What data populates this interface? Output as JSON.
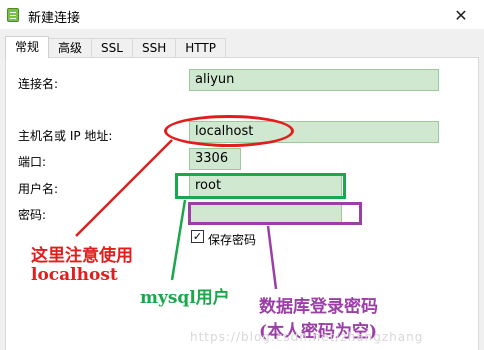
{
  "window": {
    "title": "新建连接",
    "close_glyph": "✕"
  },
  "tabs": [
    {
      "label": "常规"
    },
    {
      "label": "高级"
    },
    {
      "label": "SSL"
    },
    {
      "label": "SSH"
    },
    {
      "label": "HTTP"
    }
  ],
  "form": {
    "connection_name_label": "连接名:",
    "connection_name_value": "aliyun",
    "host_label": "主机名或 IP 地址:",
    "host_value": "localhost",
    "port_label": "端口:",
    "port_value": "3306",
    "user_label": "用户名:",
    "user_value": "root",
    "password_label": "密码:",
    "password_value": "",
    "save_password_label": "保存密码",
    "save_password_checked": true
  },
  "annotations": {
    "red_line1": "这里注意使用",
    "red_line2": "localhost",
    "green": "mysql用户",
    "purple_line1": "数据库登录密码",
    "purple_line2": "(本人密码为空)",
    "colors": {
      "red": "#e31c1c",
      "green": "#1aa84c",
      "purple": "#9b3fa7"
    }
  },
  "watermark": "https://blog.csdn.net/zhangzhang"
}
